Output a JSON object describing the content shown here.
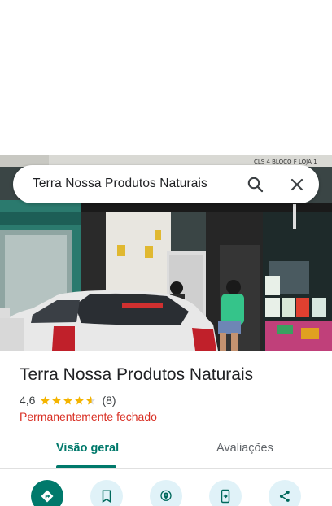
{
  "search": {
    "query": "Terra Nossa Produtos Naturais",
    "search_icon": "search-icon",
    "close_icon": "close-icon"
  },
  "photo": {
    "sign_text": "CLS 4 BLOCO F LOJA 1"
  },
  "place": {
    "name": "Terra Nossa Produtos Naturais",
    "rating": "4,6",
    "stars": 4.6,
    "review_count": "(8)",
    "status": "Permanentemente fechado",
    "status_color": "#d93025"
  },
  "tabs": [
    {
      "label": "Visão geral",
      "active": true
    },
    {
      "label": "Avaliações",
      "active": false
    }
  ],
  "actions": [
    {
      "icon": "directions-icon"
    },
    {
      "icon": "save-bookmark-icon"
    },
    {
      "icon": "nearby-icon"
    },
    {
      "icon": "send-to-phone-icon"
    },
    {
      "icon": "share-icon"
    }
  ],
  "colors": {
    "accent": "#00796b",
    "action_bg": "#e0f2f8",
    "star": "#f4b400"
  }
}
